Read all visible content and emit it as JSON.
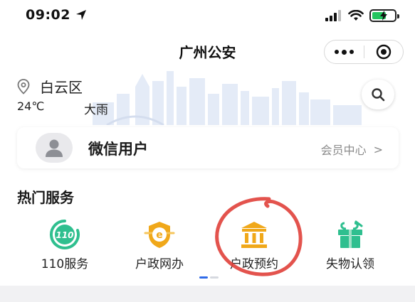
{
  "status_bar": {
    "time": "09:02"
  },
  "nav": {
    "title": "广州公安"
  },
  "header": {
    "location": "白云区",
    "temperature": "24℃",
    "weather": "大雨"
  },
  "user_card": {
    "name": "微信用户",
    "member_center": "会员中心",
    "chevron": ">"
  },
  "hot_services": {
    "title": "热门服务",
    "items": [
      {
        "label": "110服务",
        "icon": "110-icon",
        "color": "#2fbf8f"
      },
      {
        "label": "户政网办",
        "icon": "e-badge-icon",
        "color": "#f0a81a"
      },
      {
        "label": "户政预约",
        "icon": "bank-building-icon",
        "color": "#f0a81a"
      },
      {
        "label": "失物认领",
        "icon": "gift-box-icon",
        "color": "#2fbf8f"
      }
    ]
  },
  "colors": {
    "accent_green": "#2fbf8f",
    "accent_orange": "#f0a81a",
    "annotation_red": "#e0403a",
    "pager_active": "#2f6ae8"
  }
}
